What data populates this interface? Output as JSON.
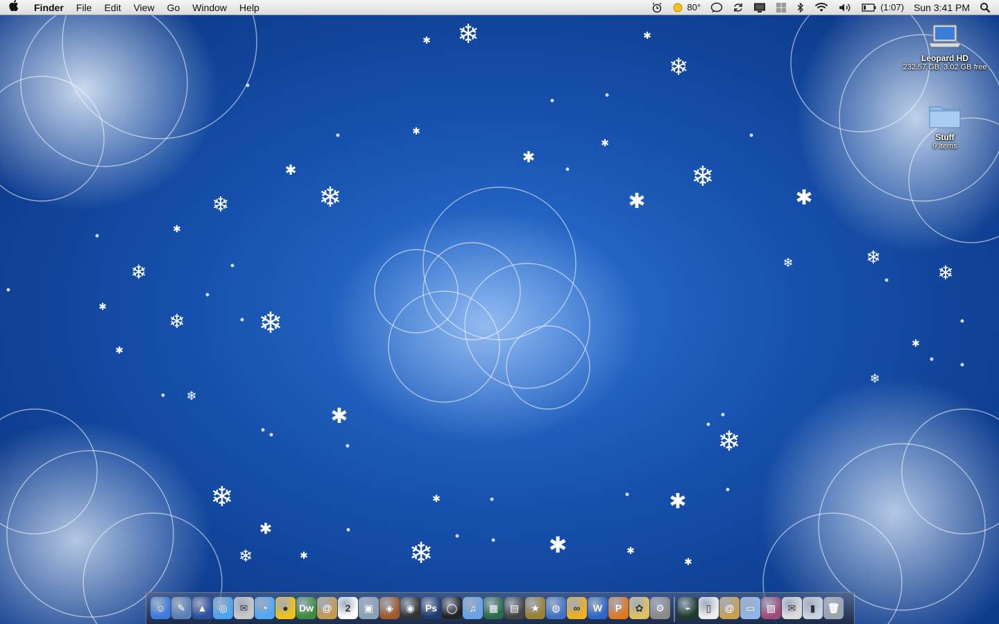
{
  "menubar": {
    "apple": "",
    "menus": [
      "Finder",
      "File",
      "Edit",
      "View",
      "Go",
      "Window",
      "Help"
    ],
    "status": {
      "temperature": "80°",
      "battery": "(1:07)",
      "clock": "Sun 3:41 PM"
    }
  },
  "desktop": {
    "icons": [
      {
        "label": "Leopard HD",
        "sub": "232.57 GB, 3.02 GB free",
        "icon": "laptop-drive-icon"
      },
      {
        "label": "Stuff",
        "sub": "9 items",
        "icon": "folder-icon"
      }
    ]
  },
  "dock": {
    "apps": [
      {
        "name": "finder",
        "glyph": "☺",
        "color": "#3b7be0"
      },
      {
        "name": "preview",
        "glyph": "✎",
        "color": "#5a7fb8"
      },
      {
        "name": "rocket",
        "glyph": "▲",
        "color": "#2b4fa0"
      },
      {
        "name": "safari",
        "glyph": "◎",
        "color": "#4aa3f0"
      },
      {
        "name": "mail-stamp",
        "glyph": "✉",
        "color": "#c8c8c8"
      },
      {
        "name": "ichat",
        "glyph": "◔",
        "color": "#4fa8f5"
      },
      {
        "name": "adium-duck",
        "glyph": "●",
        "color": "#f2c21a"
      },
      {
        "name": "dreamweaver",
        "glyph": "Dw",
        "color": "#3c8f3a"
      },
      {
        "name": "address-book",
        "glyph": "@",
        "color": "#c49a52"
      },
      {
        "name": "ical",
        "glyph": "2",
        "color": "#ffffff"
      },
      {
        "name": "iphoto",
        "glyph": "▣",
        "color": "#8aa1b8"
      },
      {
        "name": "photo-booth",
        "glyph": "◈",
        "color": "#a05a2a"
      },
      {
        "name": "dvd-player",
        "glyph": "◉",
        "color": "#333333"
      },
      {
        "name": "photoshop",
        "glyph": "Ps",
        "color": "#1d3b6e"
      },
      {
        "name": "quicktime",
        "glyph": "◯",
        "color": "#222222"
      },
      {
        "name": "itunes",
        "glyph": "♫",
        "color": "#6aa2e8"
      },
      {
        "name": "final-cut",
        "glyph": "▦",
        "color": "#2a6b4a"
      },
      {
        "name": "clapper",
        "glyph": "▤",
        "color": "#444444"
      },
      {
        "name": "imovie-star",
        "glyph": "★",
        "color": "#9a8030"
      },
      {
        "name": "dvd-studio",
        "glyph": "◍",
        "color": "#3e74c8"
      },
      {
        "name": "photo-app",
        "glyph": "∞",
        "color": "#f0b020"
      },
      {
        "name": "wordpress",
        "glyph": "W",
        "color": "#2b66c9"
      },
      {
        "name": "pages",
        "glyph": "P",
        "color": "#e07820"
      },
      {
        "name": "alarm",
        "glyph": "✿",
        "color": "#e0c060"
      },
      {
        "name": "system-prefs",
        "glyph": "⚙",
        "color": "#8a8a8a"
      },
      {
        "name": "activity-monitor",
        "glyph": "⌁",
        "color": "#1d3d2a"
      },
      {
        "name": "document",
        "glyph": "▯",
        "color": "#eeeeee"
      },
      {
        "name": "notes-folder",
        "glyph": "@",
        "color": "#c9a055"
      },
      {
        "name": "downloads-folder",
        "glyph": "▭",
        "color": "#8fb7e8"
      },
      {
        "name": "photo-stack",
        "glyph": "▧",
        "color": "#a04a7a"
      },
      {
        "name": "mail-stack",
        "glyph": "✉",
        "color": "#dddddd"
      },
      {
        "name": "apps-folder",
        "glyph": "▮",
        "color": "#c9d4e0"
      },
      {
        "name": "trash",
        "glyph": "🗑",
        "color": "#9aa5b0"
      }
    ]
  }
}
